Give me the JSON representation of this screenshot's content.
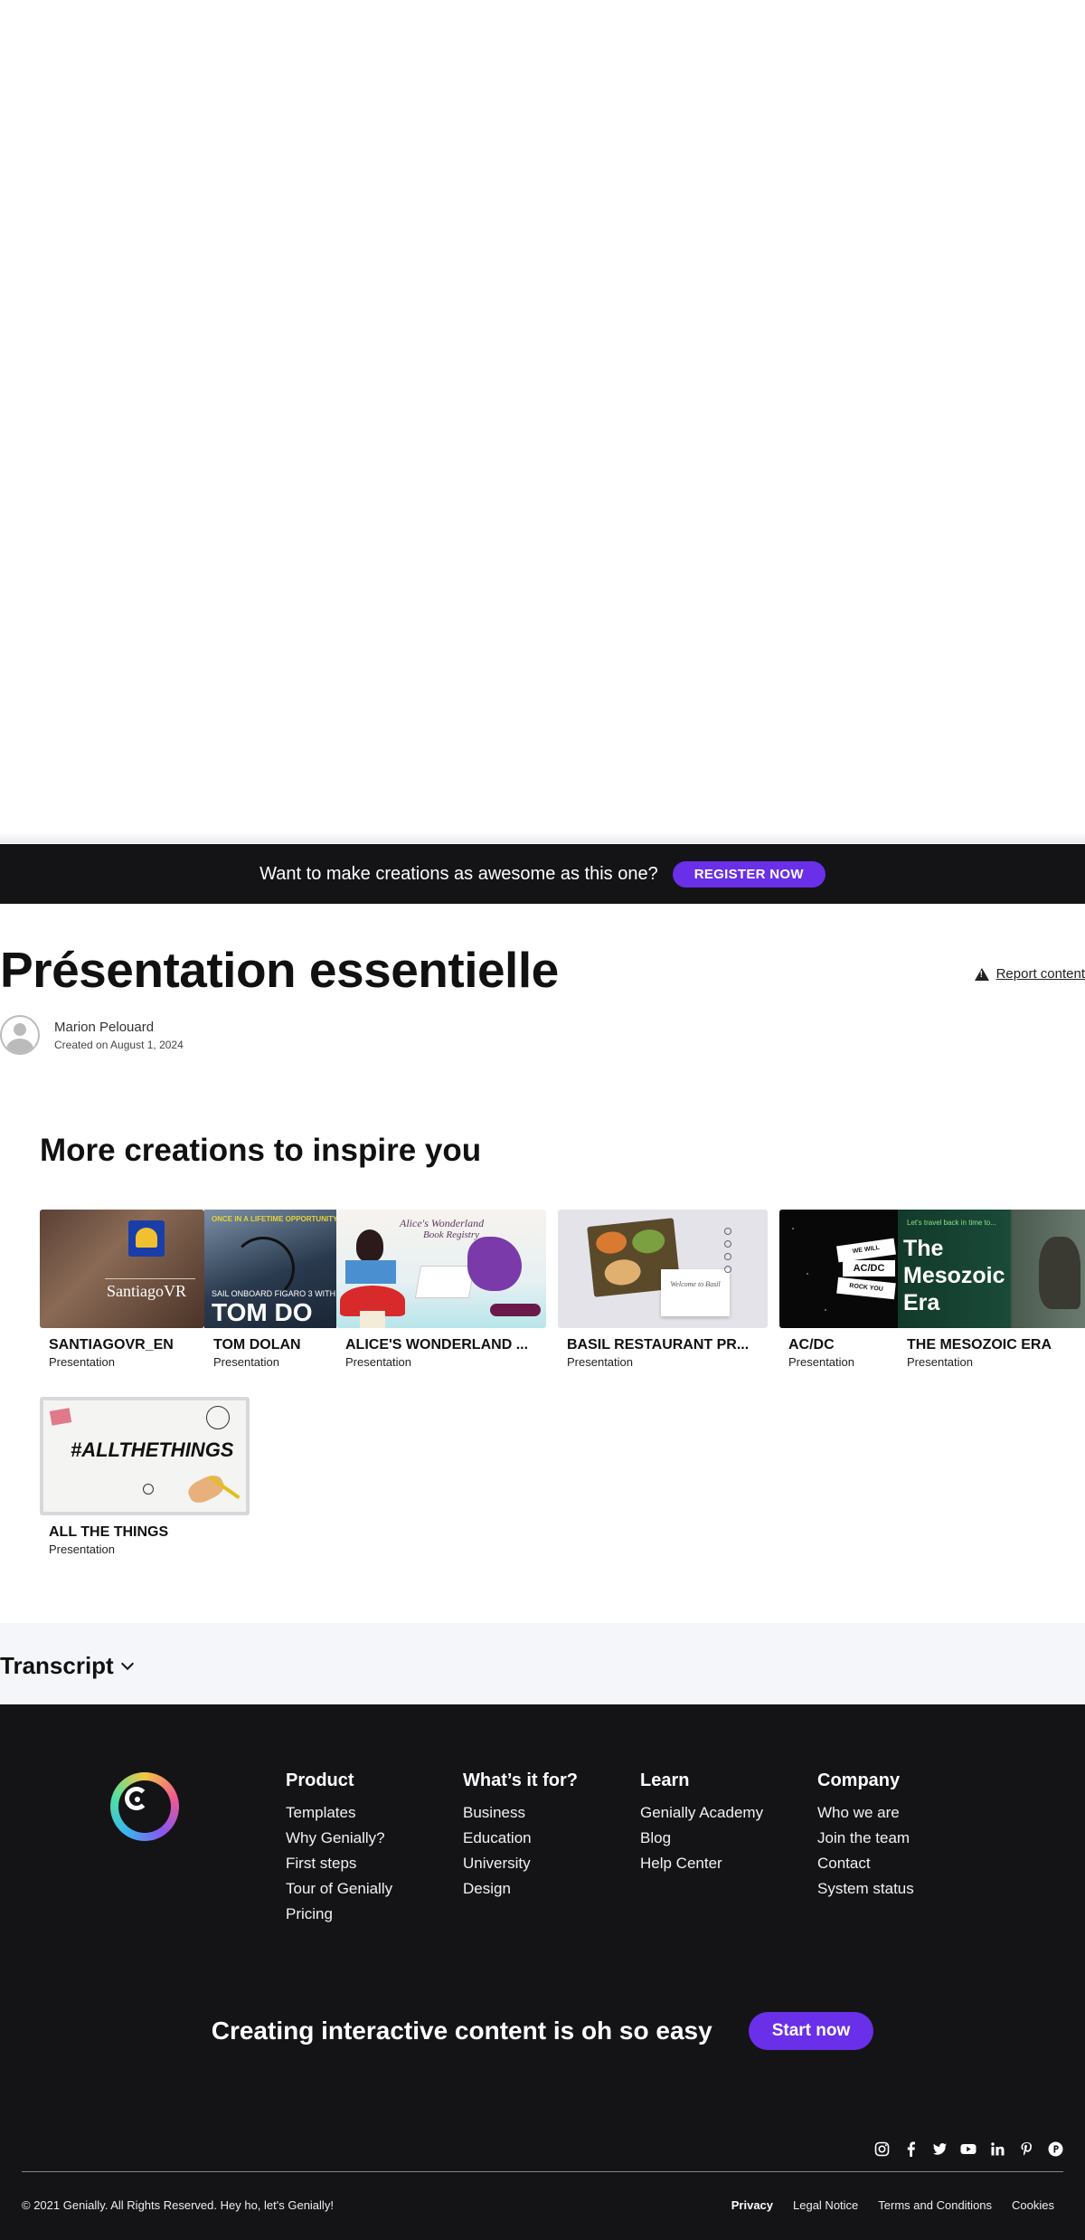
{
  "banner": {
    "text": "Want to make creations as awesome as this one?",
    "button": "REGISTER NOW"
  },
  "page": {
    "title": "Présentation essentielle",
    "report": "Report content"
  },
  "author": {
    "name": "Marion Pelouard",
    "created": "Created on August 1, 2024"
  },
  "more": {
    "title": "More creations to inspire you",
    "cards": [
      {
        "title": "SANTIAGOVR_EN",
        "type": "Presentation",
        "thumb_text": "SantiagoVR"
      },
      {
        "title": "TOM DOLAN",
        "type": "Presentation",
        "thumb_text": "TOM DO",
        "thumb_top": "ONCE IN A LIFETIME OPPORTUNITY",
        "thumb_sub": "SAIL ONBOARD FIGARO 3 WITH"
      },
      {
        "title": "ALICE'S WONDERLAND ...",
        "type": "Presentation",
        "thumb_text": "Alice's Wonderland",
        "thumb_sub": "Book Registry"
      },
      {
        "title": "BASIL RESTAURANT PR...",
        "type": "Presentation",
        "thumb_text": "Welcome to Basil"
      },
      {
        "title": "AC/DC",
        "type": "Presentation",
        "thumb_text": "AC/DC",
        "thumb_top": "WE WILL",
        "thumb_sub": "ROCK YOU"
      },
      {
        "title": "THE MESOZOIC ERA",
        "type": "Presentation",
        "thumb_text": "The Mesozoic Era",
        "thumb_top": "Let's travel back in time to..."
      },
      {
        "title": "ALL THE THINGS",
        "type": "Presentation",
        "thumb_text": "#ALLTHETHINGS"
      }
    ]
  },
  "transcript": {
    "label": "Transcript"
  },
  "footer": {
    "columns": [
      {
        "heading": "Product",
        "links": [
          "Templates",
          "Why Genially?",
          "First steps",
          "Tour of Genially",
          "Pricing"
        ]
      },
      {
        "heading": "What’s it for?",
        "links": [
          "Business",
          "Education",
          "University",
          "Design"
        ]
      },
      {
        "heading": "Learn",
        "links": [
          "Genially Academy",
          "Blog",
          "Help Center"
        ]
      },
      {
        "heading": "Company",
        "links": [
          "Who we are",
          "Join the team",
          "Contact",
          "System status"
        ]
      }
    ],
    "cta": {
      "text": "Creating interactive content is oh so easy",
      "button": "Start now"
    },
    "socials": [
      "instagram-icon",
      "facebook-icon",
      "twitter-icon",
      "youtube-icon",
      "linkedin-icon",
      "pinterest-icon",
      "producthunt-icon"
    ],
    "copyright": "© 2021 Genially. All Rights Reserved. Hey ho, let's Genially! ",
    "legal": [
      "Privacy",
      "Legal Notice",
      "Terms and Conditions",
      "Cookies"
    ]
  },
  "colors": {
    "brand": "#6a2fe8",
    "footer_bg": "#141416",
    "transcript_bg": "#f5f6fa"
  }
}
